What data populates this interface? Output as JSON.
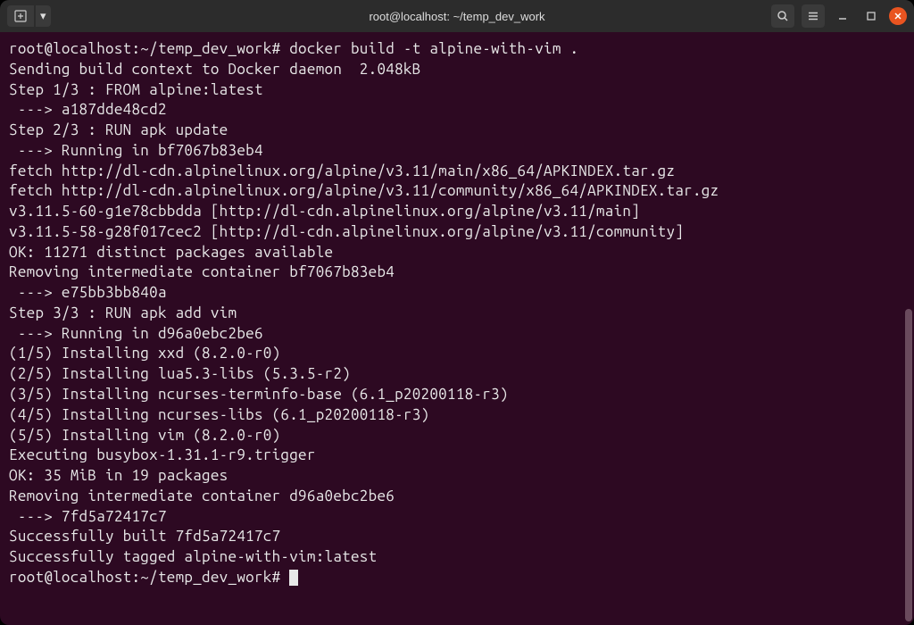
{
  "titlebar": {
    "title": "root@localhost: ~/temp_dev_work",
    "new_tab_label": "⊞",
    "new_tab_dropdown": "▾",
    "search_icon": "search",
    "menu_icon": "menu"
  },
  "terminal": {
    "prompt1": "root@localhost:~/temp_dev_work#",
    "command1": " docker build -t alpine-with-vim .",
    "lines": [
      "Sending build context to Docker daemon  2.048kB",
      "Step 1/3 : FROM alpine:latest",
      " ---> a187dde48cd2",
      "Step 2/3 : RUN apk update",
      " ---> Running in bf7067b83eb4",
      "fetch http://dl-cdn.alpinelinux.org/alpine/v3.11/main/x86_64/APKINDEX.tar.gz",
      "fetch http://dl-cdn.alpinelinux.org/alpine/v3.11/community/x86_64/APKINDEX.tar.gz",
      "v3.11.5-60-g1e78cbbdda [http://dl-cdn.alpinelinux.org/alpine/v3.11/main]",
      "v3.11.5-58-g28f017cec2 [http://dl-cdn.alpinelinux.org/alpine/v3.11/community]",
      "OK: 11271 distinct packages available",
      "Removing intermediate container bf7067b83eb4",
      " ---> e75bb3bb840a",
      "Step 3/3 : RUN apk add vim",
      " ---> Running in d96a0ebc2be6",
      "(1/5) Installing xxd (8.2.0-r0)",
      "(2/5) Installing lua5.3-libs (5.3.5-r2)",
      "(3/5) Installing ncurses-terminfo-base (6.1_p20200118-r3)",
      "(4/5) Installing ncurses-libs (6.1_p20200118-r3)",
      "(5/5) Installing vim (8.2.0-r0)",
      "Executing busybox-1.31.1-r9.trigger",
      "OK: 35 MiB in 19 packages",
      "Removing intermediate container d96a0ebc2be6",
      " ---> 7fd5a72417c7",
      "Successfully built 7fd5a72417c7",
      "Successfully tagged alpine-with-vim:latest"
    ],
    "prompt2": "root@localhost:~/temp_dev_work# "
  }
}
